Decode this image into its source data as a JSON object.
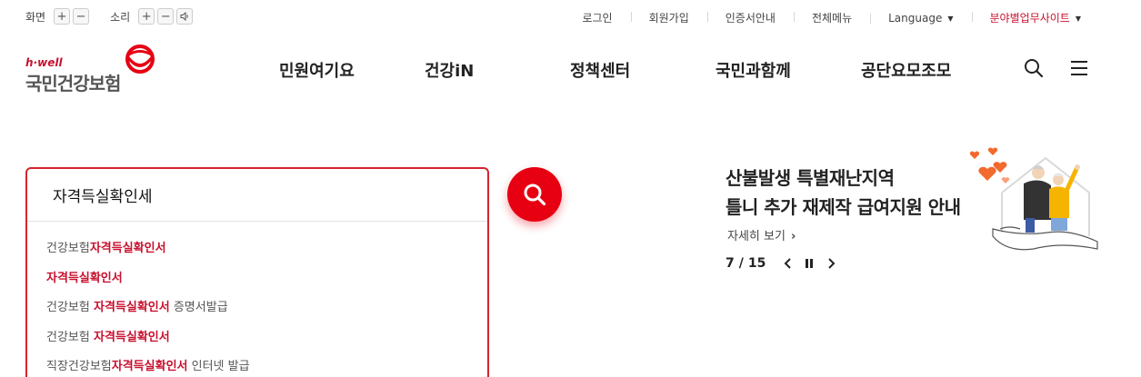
{
  "utility": {
    "screen_label": "화면",
    "sound_label": "소리",
    "plus": "+",
    "minus": "−",
    "links": {
      "login": "로그인",
      "join": "회원가입",
      "cert": "인증서안내",
      "sitemap": "전체메뉴",
      "language": "Language",
      "business": "분야별업무사이트"
    }
  },
  "logo": {
    "sub": "h·well",
    "main": "국민건강보험"
  },
  "nav": {
    "items": [
      "민원여기요",
      "건강iN",
      "정책센터",
      "국민과함께",
      "공단요모조모"
    ]
  },
  "search": {
    "value": "자격득실확인세",
    "suggestions": [
      {
        "pre": "건강보험",
        "match": "자격득실확인서",
        "post": ""
      },
      {
        "pre": "",
        "match": "자격득실확인서",
        "post": ""
      },
      {
        "pre": "건강보험 ",
        "match": "자격득실확인서",
        "post": " 증명서발급"
      },
      {
        "pre": "건강보험 ",
        "match": "자격득실확인서",
        "post": ""
      },
      {
        "pre": "직장건강보험",
        "match": "자격득실확인서",
        "post": " 인터넷 발급"
      }
    ]
  },
  "banner": {
    "title_line1": "산불발생 특별재난지역",
    "title_line2": "틀니 추가 재제작 급여지원 안내",
    "more": "자세히 보기",
    "page_current": "7",
    "page_sep": "/",
    "page_total": "15"
  },
  "colors": {
    "brand_red": "#e60012",
    "highlight_red": "#c8102e",
    "accent_orange": "#f26a2e"
  }
}
